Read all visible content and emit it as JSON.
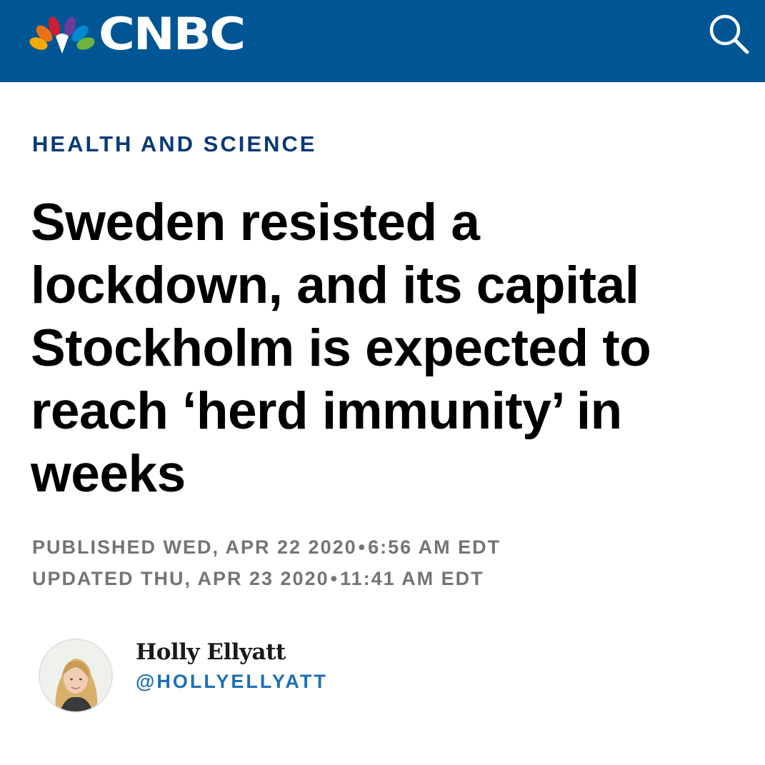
{
  "header": {
    "brand_name": "CNBC",
    "logo_icon": "nbc-peacock-icon",
    "search_icon": "search-icon",
    "background_color": "#005594"
  },
  "article": {
    "category": "HEALTH AND SCIENCE",
    "headline": "Sweden resisted a lockdown, and its capital Stockholm is expected to reach ‘herd immunity’ in weeks",
    "published_label": "PUBLISHED WED, APR 22 2020",
    "published_time": "6:56 AM EDT",
    "updated_label": "UPDATED THU, APR 23 2020",
    "updated_time": "11:41 AM EDT",
    "separator": "•"
  },
  "author": {
    "name": "Holly Ellyatt",
    "handle": "@HOLLYELLYATT",
    "avatar_icon": "avatar-photo"
  },
  "colors": {
    "category": "#0a3a75",
    "handle": "#1b6fb4",
    "dates": "#747474"
  }
}
